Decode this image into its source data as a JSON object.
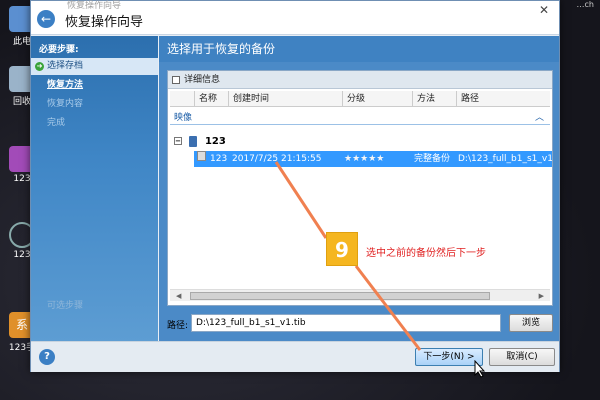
{
  "desktop": {
    "icons": [
      {
        "label": "此电",
        "name": "this-pc-icon"
      },
      {
        "label": "回收",
        "name": "recycle-bin-icon"
      },
      {
        "label": "123",
        "name": "app-123-icon"
      },
      {
        "label": "123",
        "name": "app-123-b-icon"
      },
      {
        "label": "123手",
        "name": "app-123-hand-icon"
      }
    ],
    "corner_text": "…ch"
  },
  "window": {
    "ghost_title": "恢复操作向导",
    "title": "恢复操作向导"
  },
  "sidebar": {
    "heading": "必要步骤:",
    "steps": [
      {
        "label": "选择存档",
        "state": "active"
      },
      {
        "label": "恢复方法",
        "state": "done"
      },
      {
        "label": "恢复内容",
        "state": "pending"
      },
      {
        "label": "完成",
        "state": "pending"
      }
    ],
    "faded_label": "可选步骤"
  },
  "main": {
    "header": "选择用于恢复的备份",
    "panel_title": "详细信息",
    "columns": [
      "名称",
      "创建时间",
      "分级",
      "方法",
      "路径"
    ],
    "group_label": "映像",
    "tree_item": "123",
    "backup_row": {
      "name": "123",
      "time": "2017/7/25 21:15:55",
      "rating": "★★★★★",
      "method": "完整备份",
      "path": "D:\\123_full_b1_s1_v1.tib"
    },
    "path_label": "路径:",
    "path_value": "D:\\123_full_b1_s1_v1.tib",
    "browse_label": "浏览"
  },
  "footer": {
    "help": "?",
    "next_label": "下一步(N) >",
    "cancel_label": "取消(C)"
  },
  "annotation": {
    "step_number": "9",
    "text": "选中之前的备份然后下一步",
    "color": "#e02020",
    "badge_color": "#f5b620"
  }
}
